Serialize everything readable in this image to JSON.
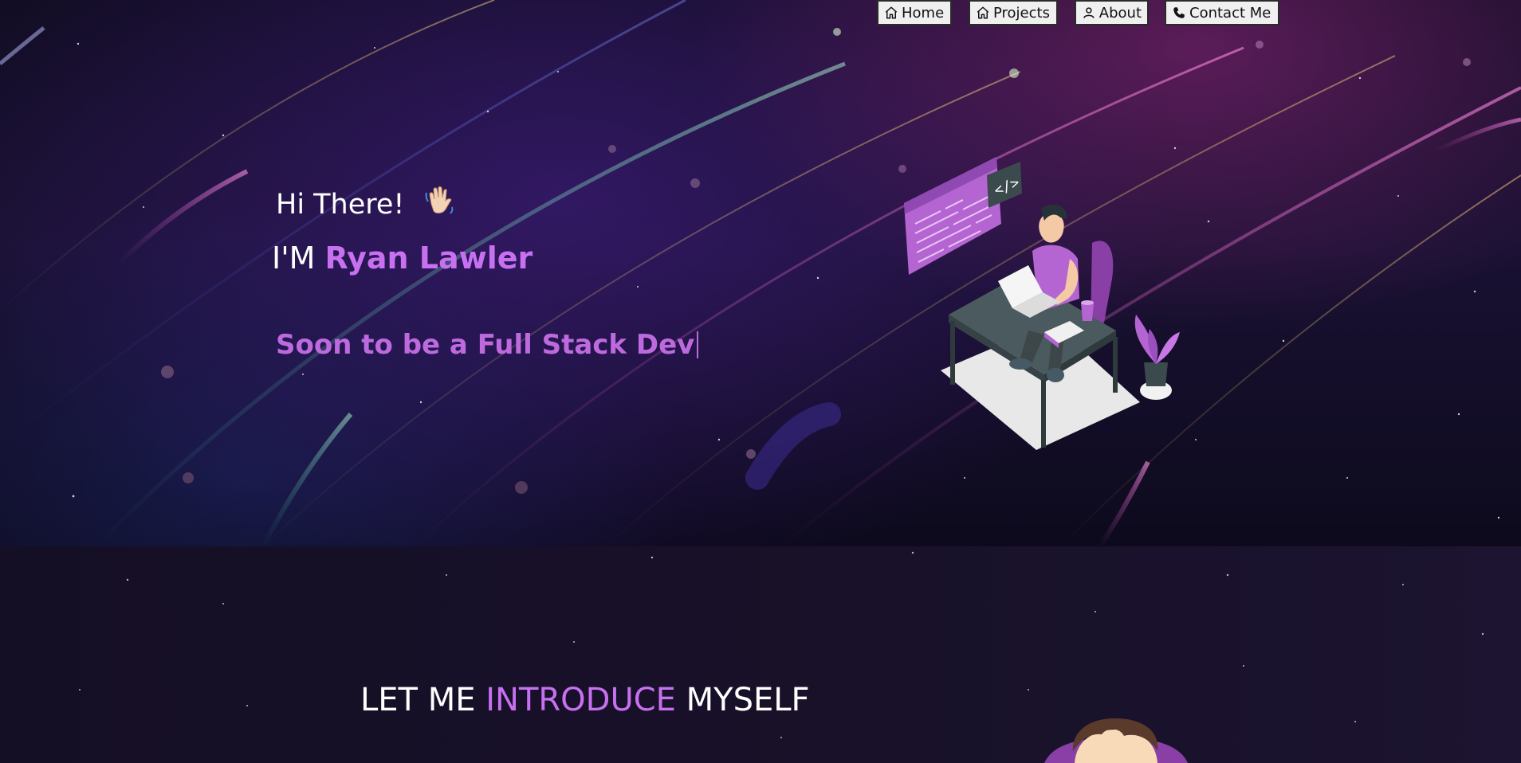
{
  "nav": {
    "items": [
      {
        "label": "Home",
        "icon": "home-icon"
      },
      {
        "label": "Projects",
        "icon": "home-icon"
      },
      {
        "label": "About",
        "icon": "user-icon"
      },
      {
        "label": "Contact Me",
        "icon": "phone-icon"
      }
    ]
  },
  "hero": {
    "greeting": "Hi There!",
    "wave_emoji": "👋",
    "intro_prefix": "I'M",
    "name": "Ryan Lawler",
    "typed_text": "Soon to be a Full Stack Dev",
    "illustration_code_tag": "</>"
  },
  "about": {
    "title_prefix": "LET ME",
    "title_accent": "INTRODUCE",
    "title_suffix": "MYSELF"
  },
  "colors": {
    "accent": "#c770f0",
    "typed": "#be6adf",
    "bg_dark": "#0c0a1a"
  }
}
